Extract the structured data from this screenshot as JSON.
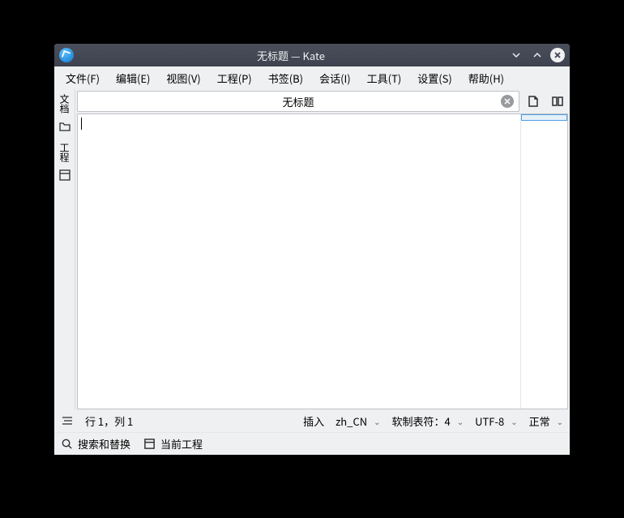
{
  "titlebar": {
    "title": "无标题 — Kate"
  },
  "menu": {
    "file": "文件(F)",
    "edit": "编辑(E)",
    "view": "视图(V)",
    "project": "工程(P)",
    "bookmarks": "书签(B)",
    "sessions": "会话(I)",
    "tools": "工具(T)",
    "settings": "设置(S)",
    "help": "帮助(H)"
  },
  "sidebar": {
    "documents": "文档",
    "projects": "工程"
  },
  "tab": {
    "title": "无标题"
  },
  "status": {
    "position": "行 1，列 1",
    "mode": "插入",
    "locale": "zh_CN",
    "tabs": "软制表符：4",
    "encoding": "UTF-8",
    "state": "正常"
  },
  "bottom": {
    "searchReplace": "搜索和替换",
    "currentProject": "当前工程"
  }
}
